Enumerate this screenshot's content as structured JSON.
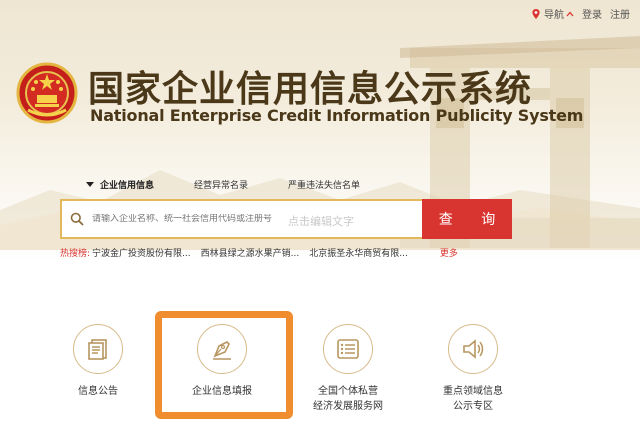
{
  "topbar": {
    "nav_label": "导航",
    "login_label": "登录",
    "register_label": "注册"
  },
  "header": {
    "title_cn": "国家企业信用信息公示系统",
    "title_en": "National Enterprise Credit Information Publicity System"
  },
  "tabs": [
    {
      "label": "企业信用信息",
      "active": true
    },
    {
      "label": "经营异常名录",
      "active": false
    },
    {
      "label": "严重违法失信名单",
      "active": false
    }
  ],
  "search": {
    "placeholder": "请输入企业名称、统一社会信用代码或注册号",
    "edit_hint": "点击编辑文字",
    "button_label": "查 询"
  },
  "hot": {
    "label": "热搜榜:",
    "items": [
      "宁波金广投资股份有限...",
      "西林县绿之源水果产销...",
      "北京振圣永华商贸有限..."
    ],
    "more_label": "更多"
  },
  "services": [
    {
      "label_line1": "信息公告",
      "label_line2": "",
      "icon": "document-icon"
    },
    {
      "label_line1": "企业信息填报",
      "label_line2": "",
      "icon": "pen-icon"
    },
    {
      "label_line1": "全国个体私营",
      "label_line2": "经济发展服务网",
      "icon": "list-icon"
    },
    {
      "label_line1": "重点领域信息",
      "label_line2": "公示专区",
      "icon": "speaker-icon"
    }
  ],
  "colors": {
    "accent_red": "#d93530",
    "gold_border": "#e2b85a",
    "title_brown": "#4a3818",
    "highlight_orange": "#f08d2e"
  }
}
